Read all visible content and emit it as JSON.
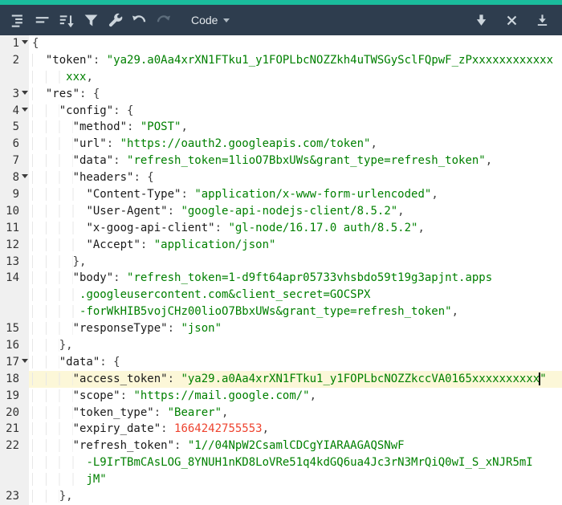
{
  "colors": {
    "accent_teal": "#1abc9c",
    "toolbar_bg": "#2e3d4e",
    "string_green": "#008000",
    "number_red": "#ee422e",
    "active_line_yellow": "#fcf7d8",
    "gutter_gray": "#f0f0f0"
  },
  "toolbar": {
    "left_buttons": [
      {
        "name": "format-button",
        "icon": "format-icon",
        "disabled": false
      },
      {
        "name": "compact-button",
        "icon": "compact-icon",
        "disabled": false
      },
      {
        "name": "sort-button",
        "icon": "sort-icon",
        "disabled": false
      },
      {
        "name": "transform-button",
        "icon": "filter-icon",
        "disabled": false
      },
      {
        "name": "repair-button",
        "icon": "wrench-icon",
        "disabled": false
      },
      {
        "name": "undo-button",
        "icon": "undo-icon",
        "disabled": false
      },
      {
        "name": "redo-button",
        "icon": "redo-icon",
        "disabled": true
      }
    ],
    "mode_select": {
      "label": "Code"
    },
    "right_buttons": [
      {
        "name": "scroll-down-button",
        "icon": "arrow-down-icon",
        "disabled": false
      },
      {
        "name": "close-button",
        "icon": "close-icon",
        "disabled": false
      },
      {
        "name": "save-button",
        "icon": "download-icon",
        "disabled": false
      }
    ]
  },
  "editor": {
    "rows": [
      {
        "line": "1",
        "fold": true,
        "segments": [
          {
            "t": "punct",
            "v": "{"
          }
        ]
      },
      {
        "line": "2",
        "segments": [
          {
            "t": "sp",
            "v": "  "
          },
          {
            "t": "key",
            "v": "\"token\""
          },
          {
            "t": "punct",
            "v": ": "
          },
          {
            "t": "str",
            "v": "\"ya29.a0Aa4xrXN1FTku1_y1FOPLbcNOZZkh4uTWSGySclFQpwF_zPxxxxxxxxxxxx"
          }
        ]
      },
      {
        "segments": [
          {
            "t": "sp",
            "v": "     "
          },
          {
            "t": "str",
            "v": "xxx"
          },
          {
            "t": "punct",
            "v": ","
          }
        ]
      },
      {
        "line": "3",
        "fold": true,
        "segments": [
          {
            "t": "sp",
            "v": "  "
          },
          {
            "t": "key",
            "v": "\"res\""
          },
          {
            "t": "punct",
            "v": ": {"
          }
        ]
      },
      {
        "line": "4",
        "fold": true,
        "segments": [
          {
            "t": "sp",
            "v": "    "
          },
          {
            "t": "key",
            "v": "\"config\""
          },
          {
            "t": "punct",
            "v": ": {"
          }
        ]
      },
      {
        "line": "5",
        "segments": [
          {
            "t": "sp",
            "v": "      "
          },
          {
            "t": "key",
            "v": "\"method\""
          },
          {
            "t": "punct",
            "v": ": "
          },
          {
            "t": "str",
            "v": "\"POST\""
          },
          {
            "t": "punct",
            "v": ","
          }
        ]
      },
      {
        "line": "6",
        "segments": [
          {
            "t": "sp",
            "v": "      "
          },
          {
            "t": "key",
            "v": "\"url\""
          },
          {
            "t": "punct",
            "v": ": "
          },
          {
            "t": "str",
            "v": "\"https://oauth2.googleapis.com/token\""
          },
          {
            "t": "punct",
            "v": ","
          }
        ]
      },
      {
        "line": "7",
        "segments": [
          {
            "t": "sp",
            "v": "      "
          },
          {
            "t": "key",
            "v": "\"data\""
          },
          {
            "t": "punct",
            "v": ": "
          },
          {
            "t": "str",
            "v": "\"refresh_token=1lioO7BbxUWs&grant_type=refresh_token\""
          },
          {
            "t": "punct",
            "v": ","
          }
        ]
      },
      {
        "line": "8",
        "fold": true,
        "segments": [
          {
            "t": "sp",
            "v": "      "
          },
          {
            "t": "key",
            "v": "\"headers\""
          },
          {
            "t": "punct",
            "v": ": {"
          }
        ]
      },
      {
        "line": "9",
        "segments": [
          {
            "t": "sp",
            "v": "        "
          },
          {
            "t": "key",
            "v": "\"Content-Type\""
          },
          {
            "t": "punct",
            "v": ": "
          },
          {
            "t": "str",
            "v": "\"application/x-www-form-urlencoded\""
          },
          {
            "t": "punct",
            "v": ","
          }
        ]
      },
      {
        "line": "10",
        "segments": [
          {
            "t": "sp",
            "v": "        "
          },
          {
            "t": "key",
            "v": "\"User-Agent\""
          },
          {
            "t": "punct",
            "v": ": "
          },
          {
            "t": "str",
            "v": "\"google-api-nodejs-client/8.5.2\""
          },
          {
            "t": "punct",
            "v": ","
          }
        ]
      },
      {
        "line": "11",
        "segments": [
          {
            "t": "sp",
            "v": "        "
          },
          {
            "t": "key",
            "v": "\"x-goog-api-client\""
          },
          {
            "t": "punct",
            "v": ": "
          },
          {
            "t": "str",
            "v": "\"gl-node/16.17.0 auth/8.5.2\""
          },
          {
            "t": "punct",
            "v": ","
          }
        ]
      },
      {
        "line": "12",
        "segments": [
          {
            "t": "sp",
            "v": "        "
          },
          {
            "t": "key",
            "v": "\"Accept\""
          },
          {
            "t": "punct",
            "v": ": "
          },
          {
            "t": "str",
            "v": "\"application/json\""
          }
        ]
      },
      {
        "line": "13",
        "segments": [
          {
            "t": "sp",
            "v": "      "
          },
          {
            "t": "punct",
            "v": "},"
          }
        ]
      },
      {
        "line": "14",
        "segments": [
          {
            "t": "sp",
            "v": "      "
          },
          {
            "t": "key",
            "v": "\"body\""
          },
          {
            "t": "punct",
            "v": ": "
          },
          {
            "t": "str",
            "v": "\"refresh_token=1-d9ft64apr05733vhsbdo59t19g3apjnt.apps"
          }
        ]
      },
      {
        "segments": [
          {
            "t": "sp",
            "v": "       "
          },
          {
            "t": "str",
            "v": ".googleusercontent.com&client_secret=GOCSPX"
          }
        ]
      },
      {
        "segments": [
          {
            "t": "sp",
            "v": "       "
          },
          {
            "t": "str",
            "v": "-forWkHIB5vojCHz00lioO7BbxUWs&grant_type=refresh_token\""
          },
          {
            "t": "punct",
            "v": ","
          }
        ]
      },
      {
        "line": "15",
        "segments": [
          {
            "t": "sp",
            "v": "      "
          },
          {
            "t": "key",
            "v": "\"responseType\""
          },
          {
            "t": "punct",
            "v": ": "
          },
          {
            "t": "str",
            "v": "\"json\""
          }
        ]
      },
      {
        "line": "16",
        "segments": [
          {
            "t": "sp",
            "v": "    "
          },
          {
            "t": "punct",
            "v": "},"
          }
        ]
      },
      {
        "line": "17",
        "fold": true,
        "segments": [
          {
            "t": "sp",
            "v": "    "
          },
          {
            "t": "key",
            "v": "\"data\""
          },
          {
            "t": "punct",
            "v": ": {"
          }
        ]
      },
      {
        "line": "18",
        "active": true,
        "segments": [
          {
            "t": "sp",
            "v": "      "
          },
          {
            "t": "key",
            "v": "\"access_token\""
          },
          {
            "t": "punct",
            "v": ": "
          },
          {
            "t": "str",
            "v": "\"ya29.a0Aa4xrXN1FTku1_y1FOPLbcNOZZkccVA0165xxxxxxxxxx"
          },
          {
            "t": "cursor",
            "v": ""
          },
          {
            "t": "str",
            "v": "\""
          }
        ]
      },
      {
        "line": "19",
        "segments": [
          {
            "t": "sp",
            "v": "      "
          },
          {
            "t": "key",
            "v": "\"scope\""
          },
          {
            "t": "punct",
            "v": ": "
          },
          {
            "t": "str",
            "v": "\"https://mail.google.com/\""
          },
          {
            "t": "punct",
            "v": ","
          }
        ]
      },
      {
        "line": "20",
        "segments": [
          {
            "t": "sp",
            "v": "      "
          },
          {
            "t": "key",
            "v": "\"token_type\""
          },
          {
            "t": "punct",
            "v": ": "
          },
          {
            "t": "str",
            "v": "\"Bearer\""
          },
          {
            "t": "punct",
            "v": ","
          }
        ]
      },
      {
        "line": "21",
        "segments": [
          {
            "t": "sp",
            "v": "      "
          },
          {
            "t": "key",
            "v": "\"expiry_date\""
          },
          {
            "t": "punct",
            "v": ": "
          },
          {
            "t": "num",
            "v": "1664242755553"
          },
          {
            "t": "punct",
            "v": ","
          }
        ]
      },
      {
        "line": "22",
        "segments": [
          {
            "t": "sp",
            "v": "      "
          },
          {
            "t": "key",
            "v": "\"refresh_token\""
          },
          {
            "t": "punct",
            "v": ": "
          },
          {
            "t": "str",
            "v": "\"1//04NpW2CsamlCDCgYIARAAGAQSNwF"
          }
        ]
      },
      {
        "segments": [
          {
            "t": "sp",
            "v": "        "
          },
          {
            "t": "str",
            "v": "-L9IrTBmCAsLOG_8YNUH1nKD8LoVRe51q4kdGQ6ua4Jc3rN3MrQiQ0wI_S_xNJR5mI"
          }
        ]
      },
      {
        "segments": [
          {
            "t": "sp",
            "v": "        "
          },
          {
            "t": "str",
            "v": "jM\""
          }
        ]
      },
      {
        "line": "23",
        "segments": [
          {
            "t": "sp",
            "v": "    "
          },
          {
            "t": "punct",
            "v": "},"
          }
        ]
      }
    ]
  }
}
